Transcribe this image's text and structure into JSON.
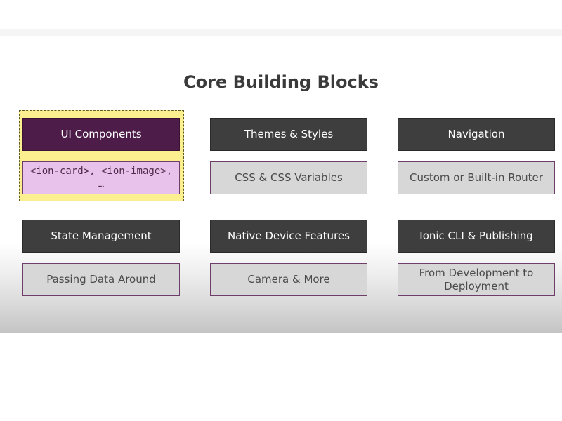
{
  "title": "Core Building Blocks",
  "colors": {
    "header_box": "#3e3e3e",
    "header_box_active": "#4d1c49",
    "sub_box": "#d7d7d7",
    "sub_box_active": "#e8c2ea",
    "highlight": "#fbef8f",
    "title_text": "#3a3a3a"
  },
  "blocks": [
    {
      "header": "UI Components",
      "detail": "<ion-card>, <ion-image>, …",
      "highlighted": true
    },
    {
      "header": "Themes & Styles",
      "detail": "CSS & CSS Variables",
      "highlighted": false
    },
    {
      "header": "Navigation",
      "detail": "Custom or Built-in Router",
      "highlighted": false
    },
    {
      "header": "State Management",
      "detail": "Passing Data Around",
      "highlighted": false
    },
    {
      "header": "Native Device Features",
      "detail": "Camera & More",
      "highlighted": false
    },
    {
      "header": "Ionic CLI & Publishing",
      "detail": "From Development to Deployment",
      "highlighted": false
    }
  ]
}
